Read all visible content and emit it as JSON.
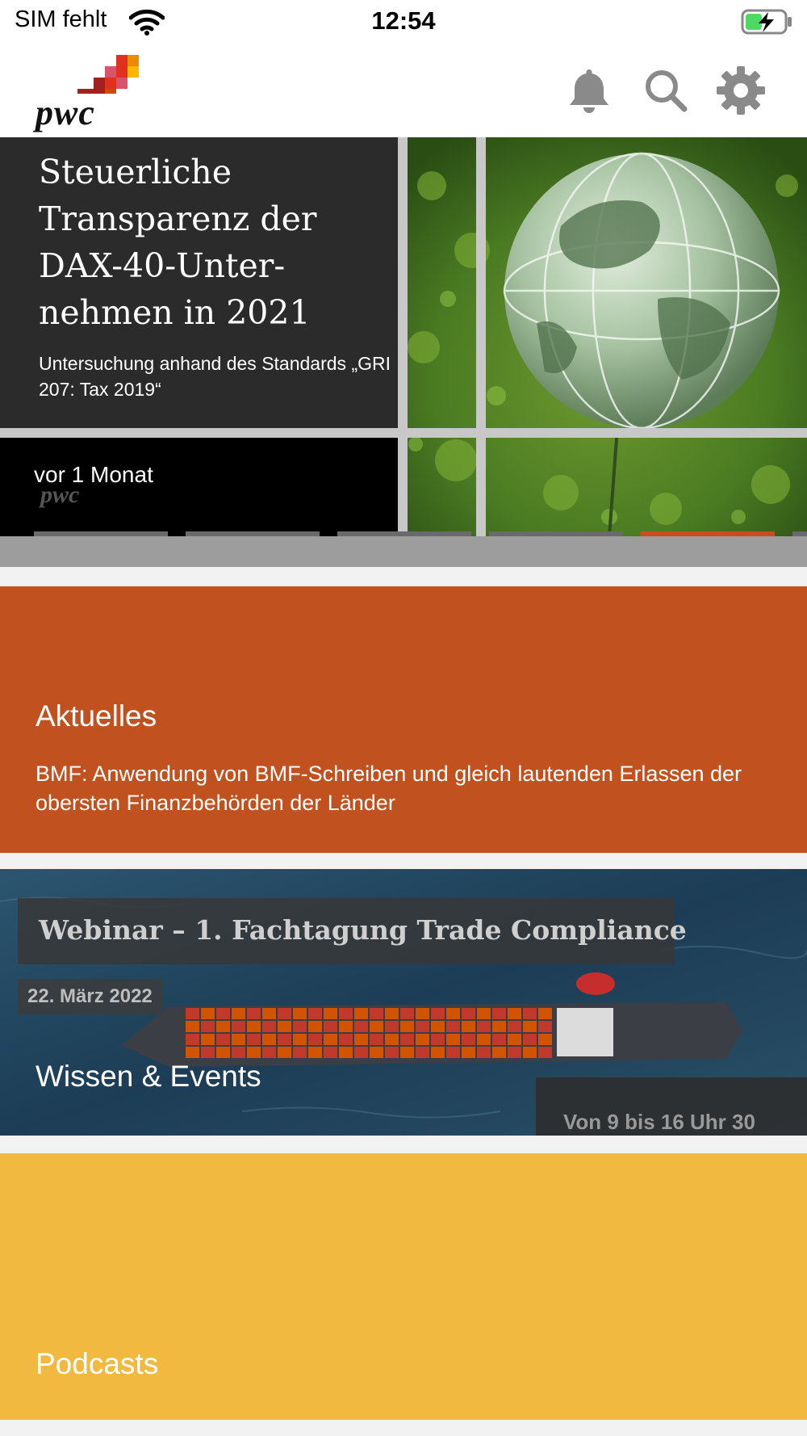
{
  "status_bar": {
    "carrier": "SIM fehlt",
    "time": "12:54",
    "wifi_icon": "wifi-icon",
    "battery_icon": "battery-charging-icon"
  },
  "header": {
    "logo_text": "pwc",
    "icons": [
      "bell-icon",
      "search-icon",
      "gear-icon"
    ]
  },
  "hero": {
    "title": "Steuerliche Transparenz der DAX-40-Unter­nehmen in 2021",
    "subtitle": "Untersuchung anhand des Standards „GRI 207: Tax 2019“",
    "date": "vor 1 Monat",
    "small_logo": "pwc",
    "pages": 6,
    "active_page": 4
  },
  "sections": {
    "aktuelles": {
      "title": "Aktuelles",
      "text": "BMF: Anwendung von BMF-Schreiben und gleich lautenden Erlassen der obersten Finanzbehörden der Länder",
      "color": "#c25120"
    },
    "events": {
      "title": "Wissen & Events",
      "webinar": "Webinar – 1. Fachtagung Trade Compliance",
      "date": "22. März 2022",
      "time": "Von 9 bis 16 Uhr 30"
    },
    "podcasts": {
      "title": "Podcasts",
      "color": "#f2b940"
    }
  }
}
